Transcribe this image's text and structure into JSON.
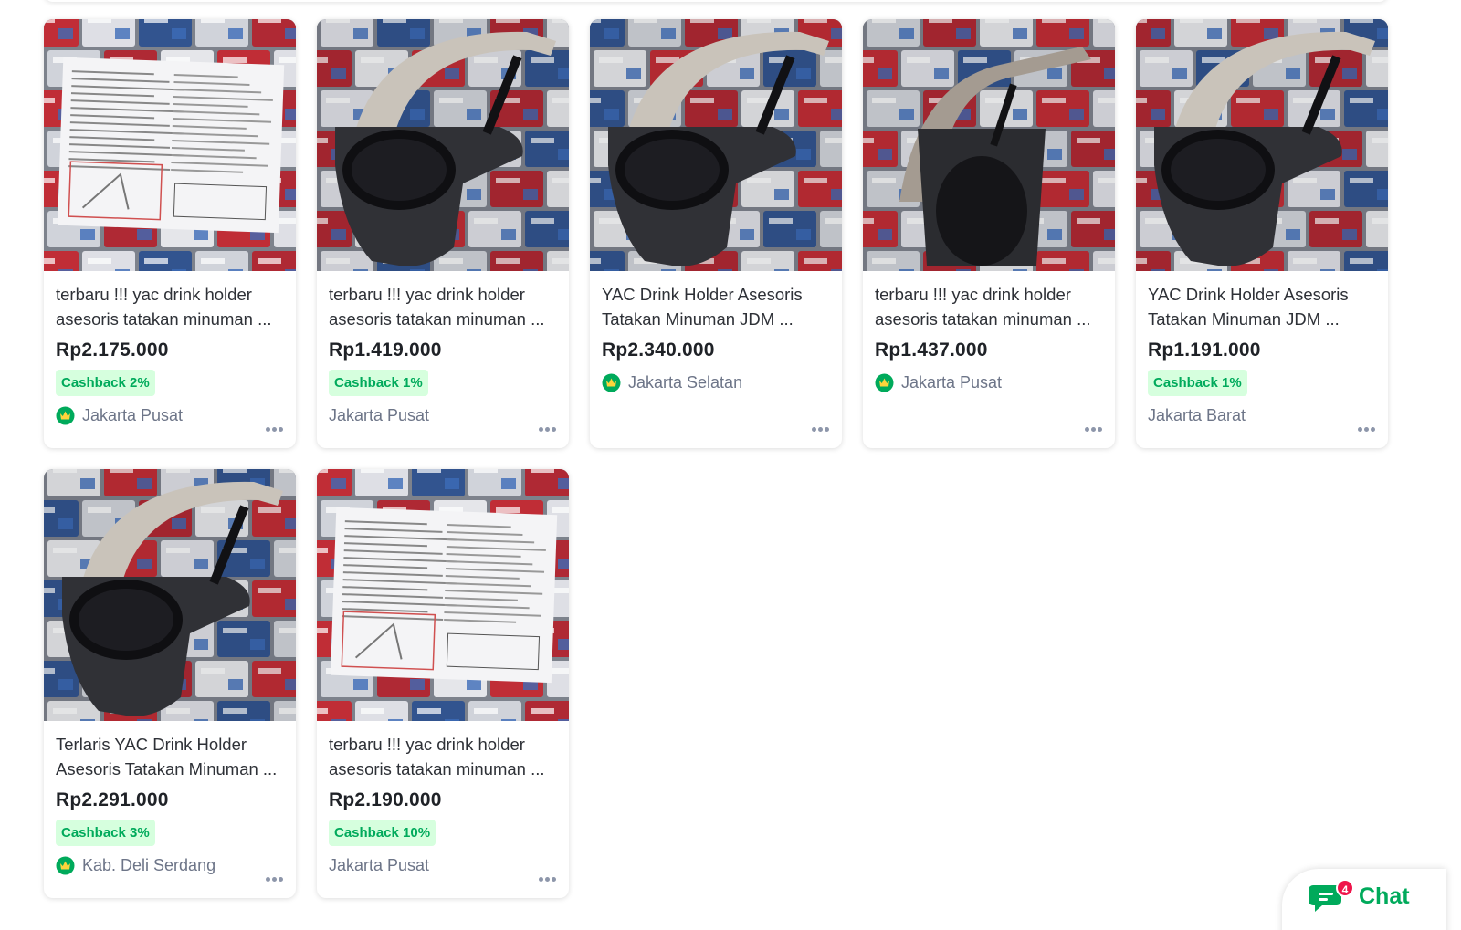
{
  "products": [
    {
      "title": "terbaru !!! yac drink holder asesoris tatakan minuman ...",
      "price": "Rp2.175.000",
      "cashback": "Cashback 2%",
      "location": "Jakarta Pusat",
      "badge": true,
      "image": "manual"
    },
    {
      "title": "terbaru !!! yac drink holder asesoris tatakan minuman ...",
      "price": "Rp1.419.000",
      "cashback": "Cashback 1%",
      "location": "Jakarta Pusat",
      "badge": false,
      "image": "holder"
    },
    {
      "title": "YAC Drink Holder Asesoris Tatakan Minuman JDM ...",
      "price": "Rp2.340.000",
      "cashback": "",
      "location": "Jakarta Selatan",
      "badge": true,
      "image": "holder"
    },
    {
      "title": "terbaru !!! yac drink holder asesoris tatakan minuman ...",
      "price": "Rp1.437.000",
      "cashback": "",
      "location": "Jakarta Pusat",
      "badge": true,
      "image": "holder-front"
    },
    {
      "title": "YAC Drink Holder Asesoris Tatakan Minuman JDM ...",
      "price": "Rp1.191.000",
      "cashback": "Cashback 1%",
      "location": "Jakarta Barat",
      "badge": false,
      "image": "holder"
    },
    {
      "title": "Terlaris YAC Drink Holder Asesoris Tatakan Minuman ...",
      "price": "Rp2.291.000",
      "cashback": "Cashback 3%",
      "location": "Kab. Deli Serdang",
      "badge": true,
      "image": "holder"
    },
    {
      "title": "terbaru !!! yac drink holder asesoris tatakan minuman ...",
      "price": "Rp2.190.000",
      "cashback": "Cashback 10%",
      "location": "Jakarta Pusat",
      "badge": false,
      "image": "manual"
    }
  ],
  "chat": {
    "label": "Chat",
    "count": "4"
  },
  "icons": {
    "more": "more-dots-icon",
    "badge": "official-store-badge-icon",
    "chat": "chat-bubble-icon"
  },
  "colors": {
    "accent": "#00aa5b",
    "cashback_bg": "#d6ffde",
    "notification": "#ef144a"
  }
}
